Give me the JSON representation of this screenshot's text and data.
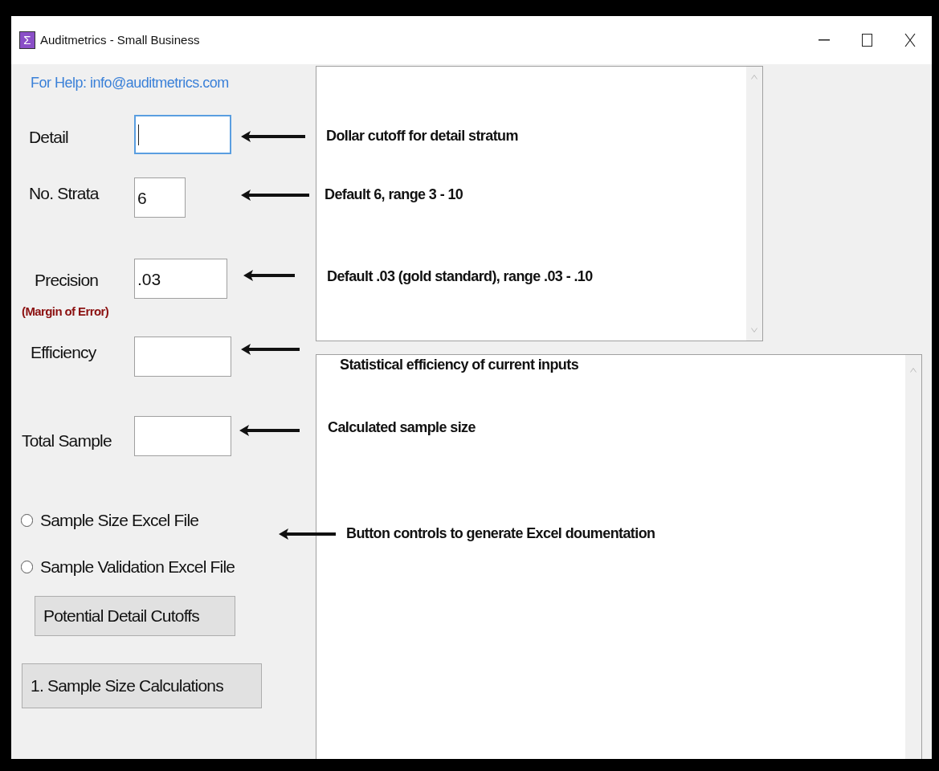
{
  "window": {
    "title": "Auditmetrics - Small Business",
    "icon_glyph": "Σ"
  },
  "help_text": "For Help: info@auditmetrics.com",
  "fields": [
    {
      "label": "Detail",
      "focused": true
    },
    {
      "label": "No. Strata",
      "value": "6",
      "focused": false
    },
    {
      "label": "Precision",
      "sublabel": "(Margin of Error)",
      "value": ".03",
      "focused": false
    },
    {
      "label": "Efficiency",
      "focused": false
    },
    {
      "label": "Total Sample",
      "focused": false
    }
  ],
  "radios": [
    {
      "label": "Sample Size Excel File",
      "selected": false
    },
    {
      "label": "Sample Validation Excel File",
      "selected": false
    }
  ],
  "buttons": [
    "Potential Detail Cutoffs",
    "1. Sample Size Calculations"
  ],
  "annotations": [
    {
      "text": "Dollar cutoff for detail stratum"
    },
    {
      "text": "Default 6, range 3 - 10"
    },
    {
      "text": "Default .03 (gold standard), range .03 - .10"
    },
    {
      "text": "Statistical efficiency of current inputs"
    },
    {
      "text": "Calculated sample size"
    },
    {
      "text": "Button controls to generate Excel doumentation"
    }
  ]
}
